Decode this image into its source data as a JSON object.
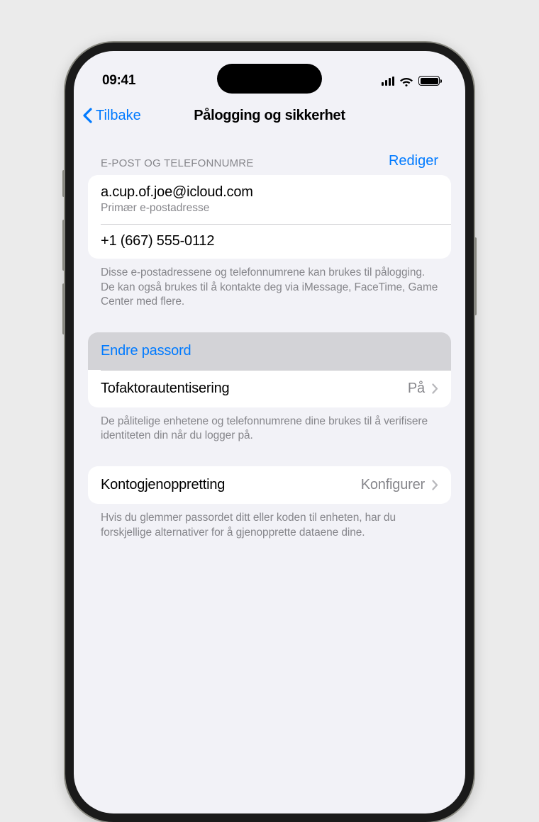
{
  "status": {
    "time": "09:41"
  },
  "nav": {
    "back": "Tilbake",
    "title": "Pålogging og sikkerhet"
  },
  "contacts_section": {
    "header": "E-POST OG TELEFONNUMRE",
    "edit": "Rediger",
    "items": [
      {
        "primary": "a.cup.of.joe@icloud.com",
        "secondary": "Primær e-postadresse"
      },
      {
        "primary": "+1 (667) 555-0112"
      }
    ],
    "footer": "Disse e-postadressene og telefonnumrene kan brukes til pålogging. De kan også brukes til å kontakte deg via iMessage, FaceTime, Game Center med flere."
  },
  "security_section": {
    "change_password": "Endre passord",
    "two_factor_label": "Tofaktorautentisering",
    "two_factor_value": "På",
    "footer": "De pålitelige enhetene og telefonnumrene dine brukes til å verifisere identiteten din når du logger på."
  },
  "recovery_section": {
    "label": "Kontogjenoppretting",
    "value": "Konfigurer",
    "footer": "Hvis du glemmer passordet ditt eller koden til enheten, har du forskjellige alternativer for å gjenopprette dataene dine."
  }
}
